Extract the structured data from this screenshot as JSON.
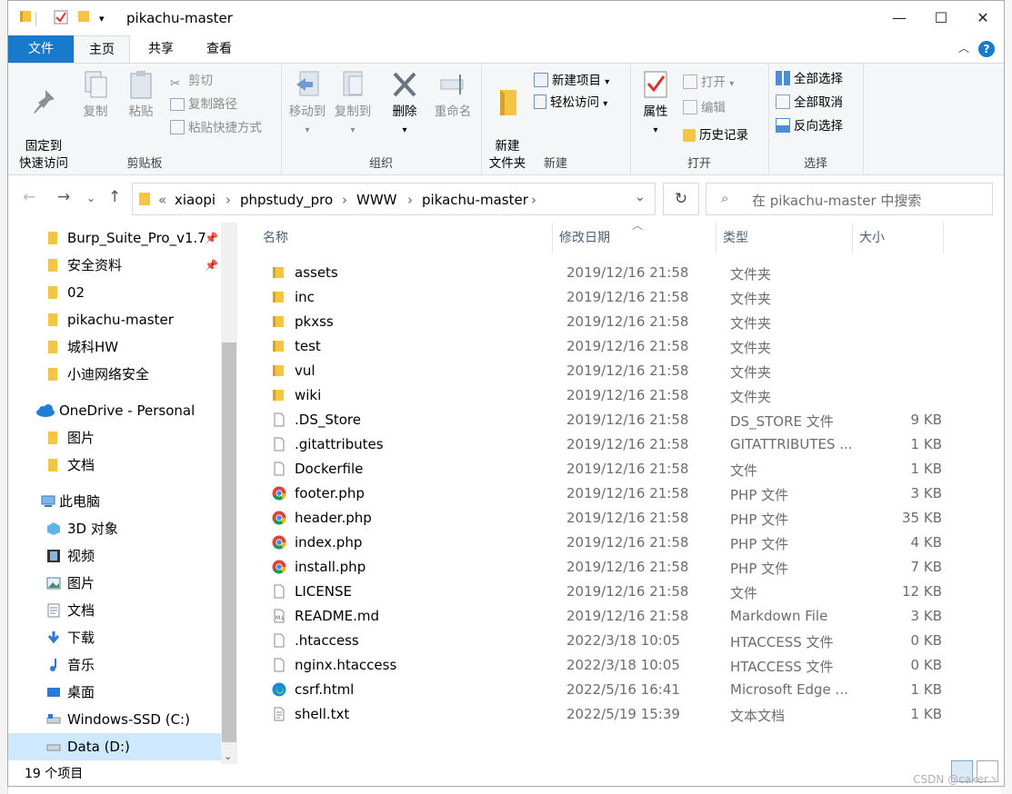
{
  "window": {
    "title": "pikachu-master"
  },
  "ribbon_tabs": {
    "file": "文件",
    "home": "主页",
    "share": "共享",
    "view": "查看"
  },
  "ribbon": {
    "clipboard": {
      "label": "剪贴板",
      "pin_quick_access": "固定到\n快速访问",
      "copy": "复制",
      "paste": "粘贴",
      "cut": "剪切",
      "copy_path": "复制路径",
      "paste_shortcut": "粘贴快捷方式"
    },
    "organize": {
      "label": "组织",
      "move_to": "移动到",
      "copy_to": "复制到",
      "delete": "删除",
      "rename": "重命名"
    },
    "new": {
      "label": "新建",
      "new_folder": "新建\n文件夹",
      "new_item": "新建项目",
      "easy_access": "轻松访问"
    },
    "open": {
      "label": "打开",
      "properties": "属性",
      "open": "打开",
      "edit": "编辑",
      "history": "历史记录"
    },
    "select": {
      "label": "选择",
      "select_all": "全部选择",
      "select_none": "全部取消",
      "invert": "反向选择"
    }
  },
  "address": {
    "overflow": "«",
    "crumbs": [
      "xiaopi",
      "phpstudy_pro",
      "WWW",
      "pikachu-master"
    ],
    "search_placeholder": "在 pikachu-master 中搜索"
  },
  "nav_pane": {
    "quick_access": [
      {
        "label": "Burp_Suite_Pro_v1.7",
        "pinned": true
      },
      {
        "label": "安全资料",
        "pinned": true
      },
      {
        "label": "02",
        "pinned": false
      },
      {
        "label": "pikachu-master",
        "pinned": false
      },
      {
        "label": "城科HW",
        "pinned": false
      },
      {
        "label": "小迪网络安全",
        "pinned": false
      }
    ],
    "onedrive": "OneDrive - Personal",
    "onedrive_items": [
      "图片",
      "文档"
    ],
    "this_pc": "此电脑",
    "pc_items": [
      "3D 对象",
      "视频",
      "图片",
      "文档",
      "下载",
      "音乐",
      "桌面",
      "Windows-SSD (C:)",
      "Data (D:)"
    ]
  },
  "columns": {
    "name": "名称",
    "date": "修改日期",
    "type": "类型",
    "size": "大小"
  },
  "files": [
    {
      "name": "assets",
      "date": "2019/12/16 21:58",
      "type": "文件夹",
      "size": "",
      "icon": "folder-icon"
    },
    {
      "name": "inc",
      "date": "2019/12/16 21:58",
      "type": "文件夹",
      "size": "",
      "icon": "folder-icon"
    },
    {
      "name": "pkxss",
      "date": "2019/12/16 21:58",
      "type": "文件夹",
      "size": "",
      "icon": "folder-icon"
    },
    {
      "name": "test",
      "date": "2019/12/16 21:58",
      "type": "文件夹",
      "size": "",
      "icon": "folder-icon"
    },
    {
      "name": "vul",
      "date": "2019/12/16 21:58",
      "type": "文件夹",
      "size": "",
      "icon": "folder-icon"
    },
    {
      "name": "wiki",
      "date": "2019/12/16 21:58",
      "type": "文件夹",
      "size": "",
      "icon": "folder-icon"
    },
    {
      "name": ".DS_Store",
      "date": "2019/12/16 21:58",
      "type": "DS_STORE 文件",
      "size": "9 KB",
      "icon": "file-icon"
    },
    {
      "name": ".gitattributes",
      "date": "2019/12/16 21:58",
      "type": "GITATTRIBUTES ...",
      "size": "1 KB",
      "icon": "file-icon"
    },
    {
      "name": "Dockerfile",
      "date": "2019/12/16 21:58",
      "type": "文件",
      "size": "1 KB",
      "icon": "file-icon"
    },
    {
      "name": "footer.php",
      "date": "2019/12/16 21:58",
      "type": "PHP 文件",
      "size": "3 KB",
      "icon": "chrome-icon"
    },
    {
      "name": "header.php",
      "date": "2019/12/16 21:58",
      "type": "PHP 文件",
      "size": "35 KB",
      "icon": "chrome-icon"
    },
    {
      "name": "index.php",
      "date": "2019/12/16 21:58",
      "type": "PHP 文件",
      "size": "4 KB",
      "icon": "chrome-icon"
    },
    {
      "name": "install.php",
      "date": "2019/12/16 21:58",
      "type": "PHP 文件",
      "size": "7 KB",
      "icon": "chrome-icon"
    },
    {
      "name": "LICENSE",
      "date": "2019/12/16 21:58",
      "type": "文件",
      "size": "12 KB",
      "icon": "file-icon"
    },
    {
      "name": "README.md",
      "date": "2019/12/16 21:58",
      "type": "Markdown File",
      "size": "3 KB",
      "icon": "markdown-file-icon"
    },
    {
      "name": ".htaccess",
      "date": "2022/3/18 10:05",
      "type": "HTACCESS 文件",
      "size": "0 KB",
      "icon": "file-icon"
    },
    {
      "name": "nginx.htaccess",
      "date": "2022/3/18 10:05",
      "type": "HTACCESS 文件",
      "size": "0 KB",
      "icon": "file-icon"
    },
    {
      "name": "csrf.html",
      "date": "2022/5/16 16:41",
      "type": "Microsoft Edge ...",
      "size": "1 KB",
      "icon": "edge-icon"
    },
    {
      "name": "shell.txt",
      "date": "2022/5/19 15:39",
      "type": "文本文档",
      "size": "1 KB",
      "icon": "text-file-icon"
    }
  ],
  "status": {
    "count": "19 个项目"
  },
  "watermark": "CSDN @caker丶",
  "colors": {
    "accent": "#1979ca",
    "folder": "#f4c542",
    "ribbon_bg": "#f5f6f7"
  }
}
